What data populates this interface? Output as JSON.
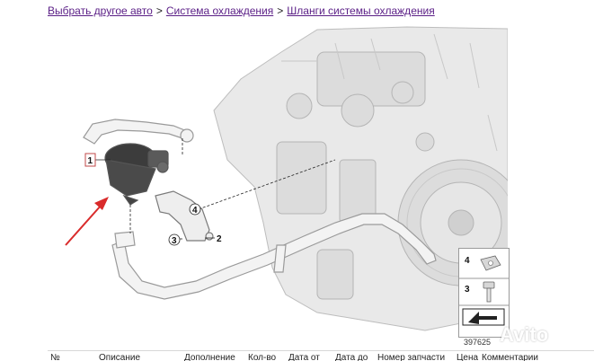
{
  "breadcrumb": {
    "item1": "Выбрать другое авто",
    "item2": "Система охлаждения",
    "item3": "Шланги системы охлаждения",
    "separator": ">"
  },
  "diagram": {
    "callouts": [
      "1",
      "2",
      "3",
      "4"
    ],
    "legend_labels": [
      "4",
      "3"
    ],
    "image_number": "397625"
  },
  "table_header": {
    "columns": [
      "№",
      "Описание",
      "Дополнение",
      "Кол-во",
      "Дата от",
      "Дата до",
      "Номер запчасти",
      "Цена",
      "Комментарии"
    ]
  },
  "watermark": "Avito",
  "colors": {
    "link": "#5a1e86",
    "arrow": "#d92b2b"
  }
}
